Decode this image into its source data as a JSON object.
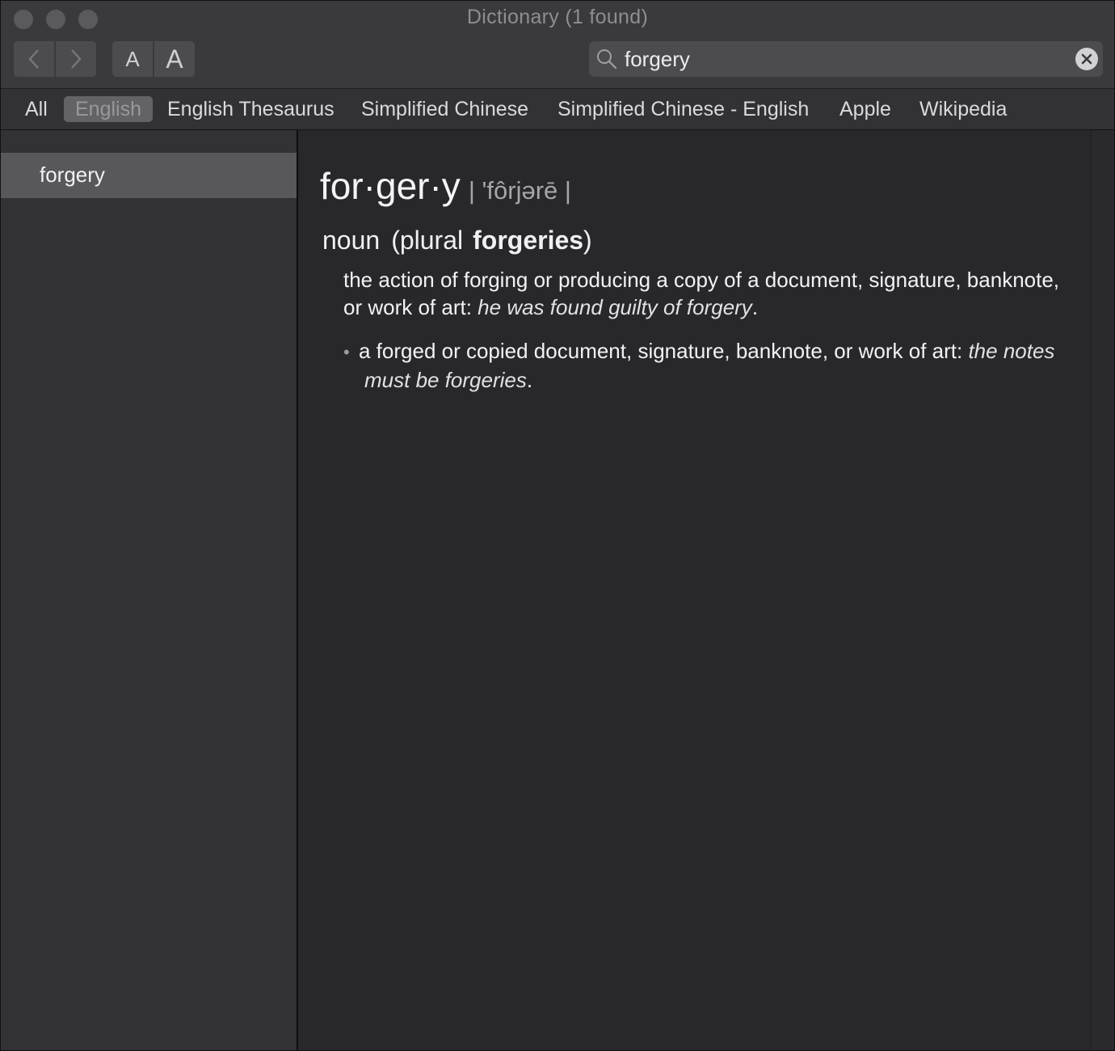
{
  "window": {
    "title": "Dictionary (1 found)"
  },
  "toolbar": {
    "back_icon": "chevron-left-icon",
    "forward_icon": "chevron-right-icon",
    "font_smaller_label": "A",
    "font_larger_label": "A",
    "search_value": "forgery",
    "search_icon": "magnifier-icon",
    "clear_icon": "clear-circle-icon"
  },
  "scope_tabs": [
    {
      "label": "All",
      "selected": false
    },
    {
      "label": "English",
      "selected": true
    },
    {
      "label": "English Thesaurus",
      "selected": false
    },
    {
      "label": "Simplified Chinese",
      "selected": false
    },
    {
      "label": "Simplified Chinese - English",
      "selected": false
    },
    {
      "label": "Apple",
      "selected": false
    },
    {
      "label": "Wikipedia",
      "selected": false
    }
  ],
  "sidebar": {
    "items": [
      {
        "label": "forgery",
        "selected": true
      }
    ]
  },
  "entry": {
    "headword": "for·ger·y",
    "pronunciation": "| 'fôrjərē |",
    "part_of_speech": "noun",
    "plural_open": "(plural",
    "plural_form": "forgeries",
    "plural_close": ")",
    "senses": [
      {
        "definition": "the action of forging or producing a copy of a document, signature, banknote, or work of art:",
        "example": "he was found guilty of forgery",
        "end": "."
      },
      {
        "bullet": "•",
        "definition": "a forged or copied document, signature, banknote, or work of art:",
        "example": "the notes must be forgeries",
        "end": "."
      }
    ]
  },
  "colors": {
    "window_background": "#2b2b2d",
    "toolbar_background": "#3a3a3c",
    "selected_tab_background": "#636366",
    "sidebar_selection": "#58585b"
  }
}
